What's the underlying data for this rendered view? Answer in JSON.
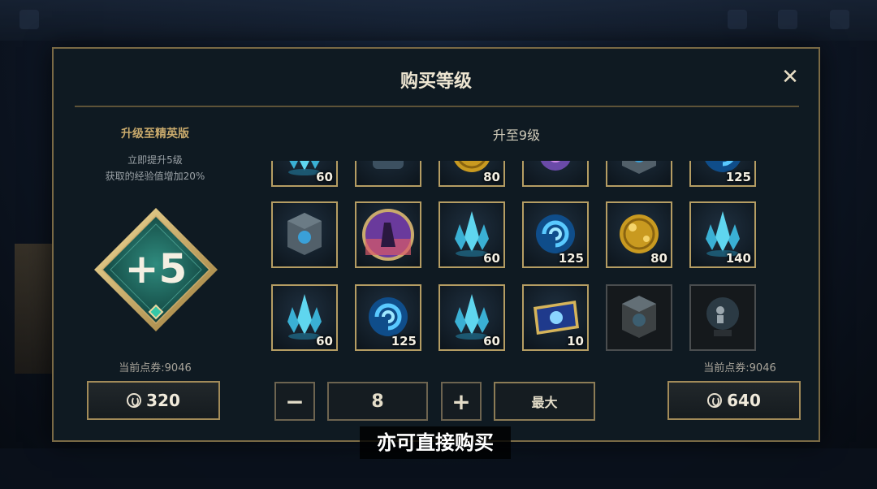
{
  "modal": {
    "title": "购买等级",
    "close_label": "✕"
  },
  "left_panel": {
    "title": "升级至精英版",
    "desc_line1": "立即提升5级",
    "desc_line2": "获取的经验值增加20%",
    "emblem_text": "+5",
    "balance_text": "当前点券:9046",
    "price": "320"
  },
  "right_panel": {
    "title": "升至9级",
    "balance_text": "当前点券:9046",
    "price": "640",
    "quantity": "8",
    "minus_label": "−",
    "plus_label": "+",
    "max_label": "最大"
  },
  "rewards": {
    "row_partial": [
      {
        "icon": "crystal-icon",
        "count": "60"
      },
      {
        "icon": "capsule-icon",
        "count": ""
      },
      {
        "icon": "orb-icon",
        "count": "80"
      },
      {
        "icon": "emote-icon",
        "count": ""
      },
      {
        "icon": "chest-icon",
        "count": ""
      },
      {
        "icon": "essence-icon",
        "count": "125"
      }
    ],
    "row_1": [
      {
        "icon": "chest-icon",
        "count": ""
      },
      {
        "icon": "icon-portrait",
        "count": ""
      },
      {
        "icon": "crystal-icon",
        "count": "60"
      },
      {
        "icon": "essence-icon",
        "count": "125"
      },
      {
        "icon": "orb-icon",
        "count": "80"
      },
      {
        "icon": "crystal-icon",
        "count": "140"
      }
    ],
    "row_2": [
      {
        "icon": "crystal-icon",
        "count": "60"
      },
      {
        "icon": "essence-icon",
        "count": "125"
      },
      {
        "icon": "crystal-icon",
        "count": "60"
      },
      {
        "icon": "ticket-icon",
        "count": "10"
      },
      {
        "icon": "chest-icon-locked",
        "count": ""
      },
      {
        "icon": "ward-globe-icon-locked",
        "count": ""
      }
    ]
  },
  "caption": "亦可直接购买",
  "colors": {
    "gold_border": "#b59d63",
    "accent_gold": "#c9aa6c",
    "panel_bg": "#0f1a22"
  }
}
